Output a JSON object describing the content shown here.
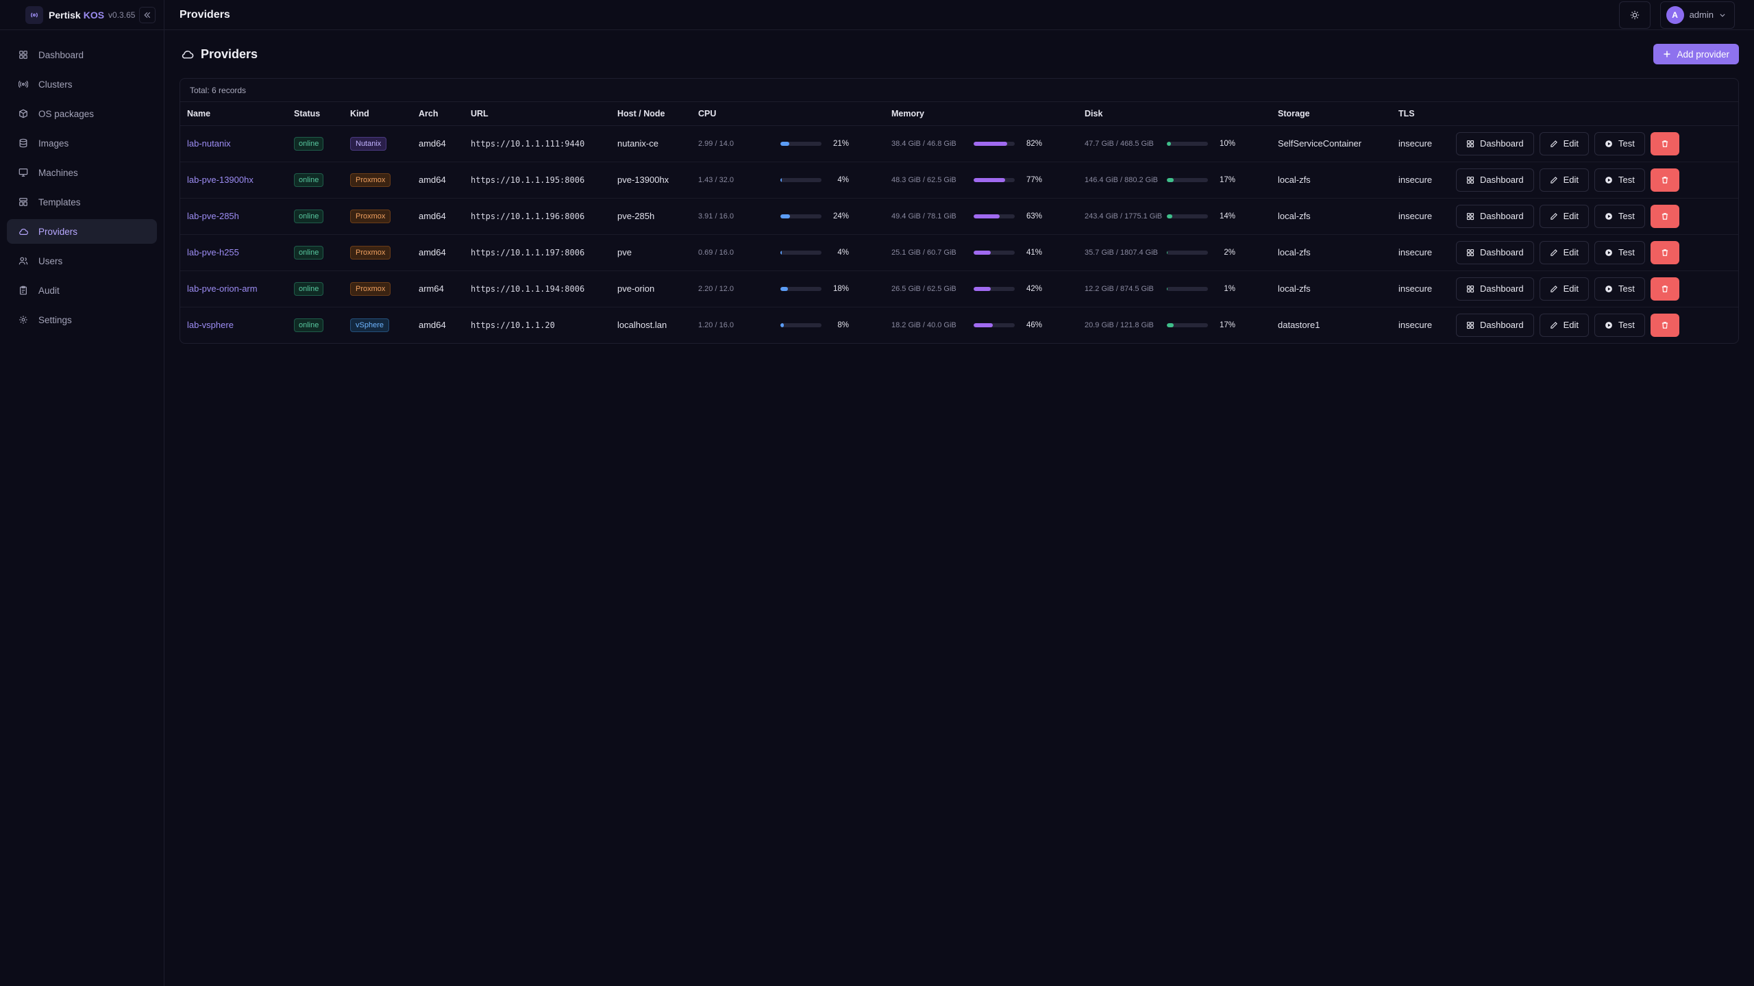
{
  "app": {
    "name": "Pertisk",
    "name_accent": "KOS",
    "version": "v0.3.65"
  },
  "sidebar": {
    "items": [
      {
        "label": "Dashboard",
        "icon": "grid-icon",
        "active": false
      },
      {
        "label": "Clusters",
        "icon": "cluster-icon",
        "active": false
      },
      {
        "label": "OS packages",
        "icon": "package-icon",
        "active": false
      },
      {
        "label": "Images",
        "icon": "database-icon",
        "active": false
      },
      {
        "label": "Machines",
        "icon": "monitor-icon",
        "active": false
      },
      {
        "label": "Templates",
        "icon": "template-icon",
        "active": false
      },
      {
        "label": "Providers",
        "icon": "cloud-icon",
        "active": true
      },
      {
        "label": "Users",
        "icon": "users-icon",
        "active": false
      },
      {
        "label": "Audit",
        "icon": "clipboard-icon",
        "active": false
      },
      {
        "label": "Settings",
        "icon": "gear-icon",
        "active": false
      }
    ]
  },
  "topbar": {
    "title": "Providers",
    "user": {
      "initial": "A",
      "name": "admin"
    }
  },
  "page": {
    "title": "Providers",
    "add_label": "Add provider",
    "total": "Total: 6 records"
  },
  "colors": {
    "accent": "#8e72ee",
    "cpu_bar": "#5b9cf5",
    "mem_bar": "#a06af0",
    "disk_bar": "#3fbf8a",
    "danger": "#f06060"
  },
  "table": {
    "columns": [
      "Name",
      "Status",
      "Kind",
      "Arch",
      "URL",
      "Host / Node",
      "CPU",
      "Memory",
      "Disk",
      "Storage",
      "TLS"
    ],
    "action_labels": {
      "dashboard": "Dashboard",
      "edit": "Edit",
      "test": "Test"
    },
    "rows": [
      {
        "name": "lab-nutanix",
        "status": "online",
        "kind": "Nutanix",
        "kind_class": "kind-nutanix",
        "arch": "amd64",
        "url": "https://10.1.1.111:9440",
        "host": "nutanix-ce",
        "cpu_text": "2.99 / 14.0",
        "cpu_pct": "21%",
        "cpu_val": 21,
        "mem_text": "38.4 GiB / 46.8 GiB",
        "mem_pct": "82%",
        "mem_val": 82,
        "disk_text": "47.7 GiB / 468.5 GiB",
        "disk_pct": "10%",
        "disk_val": 10,
        "storage": "SelfServiceContainer",
        "tls": "insecure"
      },
      {
        "name": "lab-pve-13900hx",
        "status": "online",
        "kind": "Proxmox",
        "kind_class": "kind-proxmox",
        "arch": "amd64",
        "url": "https://10.1.1.195:8006",
        "host": "pve-13900hx",
        "cpu_text": "1.43 / 32.0",
        "cpu_pct": "4%",
        "cpu_val": 4,
        "mem_text": "48.3 GiB / 62.5 GiB",
        "mem_pct": "77%",
        "mem_val": 77,
        "disk_text": "146.4 GiB / 880.2 GiB",
        "disk_pct": "17%",
        "disk_val": 17,
        "storage": "local-zfs",
        "tls": "insecure"
      },
      {
        "name": "lab-pve-285h",
        "status": "online",
        "kind": "Proxmox",
        "kind_class": "kind-proxmox",
        "arch": "amd64",
        "url": "https://10.1.1.196:8006",
        "host": "pve-285h",
        "cpu_text": "3.91 / 16.0",
        "cpu_pct": "24%",
        "cpu_val": 24,
        "mem_text": "49.4 GiB / 78.1 GiB",
        "mem_pct": "63%",
        "mem_val": 63,
        "disk_text": "243.4 GiB / 1775.1 GiB",
        "disk_pct": "14%",
        "disk_val": 14,
        "storage": "local-zfs",
        "tls": "insecure"
      },
      {
        "name": "lab-pve-h255",
        "status": "online",
        "kind": "Proxmox",
        "kind_class": "kind-proxmox",
        "arch": "amd64",
        "url": "https://10.1.1.197:8006",
        "host": "pve",
        "cpu_text": "0.69 / 16.0",
        "cpu_pct": "4%",
        "cpu_val": 4,
        "mem_text": "25.1 GiB / 60.7 GiB",
        "mem_pct": "41%",
        "mem_val": 41,
        "disk_text": "35.7 GiB / 1807.4 GiB",
        "disk_pct": "2%",
        "disk_val": 2,
        "storage": "local-zfs",
        "tls": "insecure"
      },
      {
        "name": "lab-pve-orion-arm",
        "status": "online",
        "kind": "Proxmox",
        "kind_class": "kind-proxmox",
        "arch": "arm64",
        "url": "https://10.1.1.194:8006",
        "host": "pve-orion",
        "cpu_text": "2.20 / 12.0",
        "cpu_pct": "18%",
        "cpu_val": 18,
        "mem_text": "26.5 GiB / 62.5 GiB",
        "mem_pct": "42%",
        "mem_val": 42,
        "disk_text": "12.2 GiB / 874.5 GiB",
        "disk_pct": "1%",
        "disk_val": 1,
        "storage": "local-zfs",
        "tls": "insecure"
      },
      {
        "name": "lab-vsphere",
        "status": "online",
        "kind": "vSphere",
        "kind_class": "kind-vsphere",
        "arch": "amd64",
        "url": "https://10.1.1.20",
        "host": "localhost.lan",
        "cpu_text": "1.20 / 16.0",
        "cpu_pct": "8%",
        "cpu_val": 8,
        "mem_text": "18.2 GiB / 40.0 GiB",
        "mem_pct": "46%",
        "mem_val": 46,
        "disk_text": "20.9 GiB / 121.8 GiB",
        "disk_pct": "17%",
        "disk_val": 17,
        "storage": "datastore1",
        "tls": "insecure"
      }
    ]
  }
}
